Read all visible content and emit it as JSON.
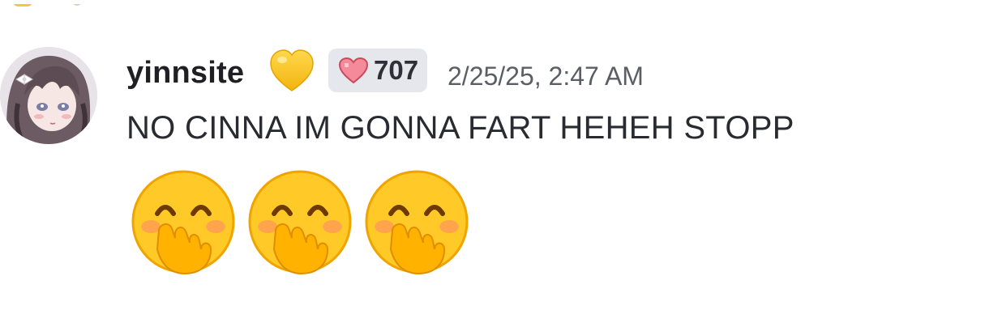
{
  "message": {
    "author": "yinnsite",
    "role_icon": "yellow-heart-icon",
    "badge": {
      "icon": "pixel-heart-icon",
      "count": "707"
    },
    "timestamp": "2/25/25, 2:47 AM",
    "text": "NO CINNA IM GONNA FART HEHEH STOPP",
    "reactions_in_body": [
      "hand-over-mouth-emoji",
      "hand-over-mouth-emoji",
      "hand-over-mouth-emoji"
    ]
  },
  "colors": {
    "username": "#1f1f24",
    "timestamp": "#5c5e66",
    "badge_bg": "#e6e7ec",
    "text": "#2a2b31",
    "heart_gold": "#f6c21b"
  }
}
